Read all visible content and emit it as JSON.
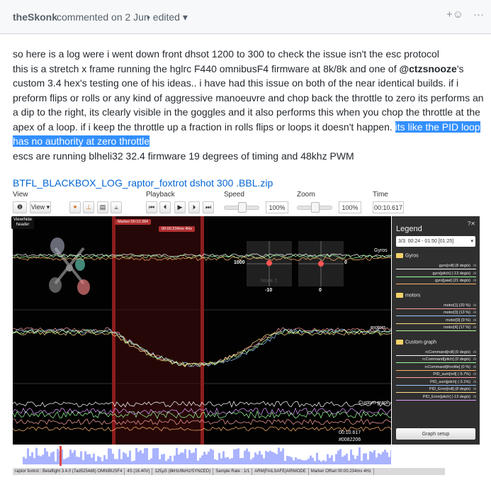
{
  "comment": {
    "author": "theSkonk",
    "meta": "commented on 2 Jun",
    "edited_label": "• edited",
    "edited_caret": "▾",
    "react_icon": "☺",
    "more_icon": "···"
  },
  "body": {
    "p1_line1": "so here is a log were i went down front dhsot 1200 to 300 to check the issue isn't the esc protocol",
    "p1_line2a": "this is a stretch x frame running the hglrc F440 omnibusF4 firmware at 8k/8k and one of ",
    "mention": "@ctzsnooze",
    "p1_line2b": "'s custom 3.4 hex's testing one of his ideas.. i have had this issue on both of the near identical builds. if i preform flips or rolls or any kind of aggressive manoeuvre and chop back the throttle to zero its performs an a dip to the right, its clearly visible in the goggles and it also performs this when you chop the throttle at the apex of a loop. if i keep the throttle up a fraction in rolls flips or loops it doesn't happen. ",
    "highlight": "its like the PID loop has no authority at zero throttle",
    "p2": "escs are running blheli32 32.4 firmware 19 degrees of timing and 48khz PWM"
  },
  "attachment": {
    "name": "BTFL_BLACKBOX_LOG_raptor_foxtrot dshot 300 .BBL.zip"
  },
  "toolbar": {
    "view_label": "View",
    "playback_label": "Playback",
    "speed_label": "Speed",
    "zoom_label": "Zoom",
    "time_label": "Time",
    "info_icon": "❶",
    "view_dropdown": "View ▾",
    "speed_value": "100%",
    "zoom_value": "100%",
    "time_value": "00:10.617",
    "tooltip": "View/hide header",
    "speed_level": 0.5,
    "zoom_level": 0.5
  },
  "graph": {
    "marker_label": "Marker:00:10.384",
    "marker_offset": "00:00.234ms 4Hz",
    "gyros_label": "Gyros",
    "motors_label": "motors",
    "custom_label": "Custom graph",
    "stick_left_value": "1000",
    "stick_right_value": "0",
    "stick_left_bottom": "-10",
    "stick_right_bottom": "0",
    "mode_label": "Mode 2",
    "cursor_time": "00:10.617",
    "cursor_frame": "#0082206"
  },
  "legend": {
    "title": "Legend",
    "help": "?✕",
    "range": "3/3: 00:24 - 01:50 [01:25]",
    "groups": [
      {
        "name": "Gyros",
        "items": [
          {
            "label": "gyro[roll] (8 deg/s)",
            "color": "#ffffff"
          },
          {
            "label": "gyro[pitch] (-13 deg/s)",
            "color": "#9aff9a"
          },
          {
            "label": "gyro[yaw] (21 deg/s)",
            "color": "#ffb36a"
          }
        ]
      },
      {
        "name": "motors",
        "items": [
          {
            "label": "motor[1] (20 %)",
            "color": "#ff9e9e"
          },
          {
            "label": "motor[3] (13 %)",
            "color": "#9ac8ff"
          },
          {
            "label": "motor[0] (9 %)",
            "color": "#ffe08a"
          },
          {
            "label": "motor[4] (17 %)",
            "color": "#b4ff9a"
          }
        ]
      },
      {
        "name": "Custom graph",
        "items": [
          {
            "label": "rcCommand[roll] (0 deg/s)",
            "color": "#ffffff"
          },
          {
            "label": "rcCommand[pitch] (0 deg/s)",
            "color": "#9aff9a"
          },
          {
            "label": "rcCommand[throttle] (0 %)",
            "color": "#ffb36a"
          },
          {
            "label": "PID_sum[roll] (-5.7%)",
            "color": "#ff9e9e"
          },
          {
            "label": "PID_sum[pitch] (-3.1%)",
            "color": "#9ac8ff"
          },
          {
            "label": "PID_Error[roll] (8 deg/s)",
            "color": "#ffe08a"
          },
          {
            "label": "PID_Error[pitch] (-13 deg/s)",
            "color": "#e0a0ff"
          }
        ]
      }
    ],
    "setup_button": "Graph setup"
  },
  "status": [
    "raptor foxtrot : Betaflight 3.4.0 (7ad5254d8) OMNIBUSF4",
    "4S (16.40V)",
    "125µS (8kHz/8kHz/SYNCED)",
    "Sample Rate : 1/1",
    "ARM|FAILSAFE|AIRMODE",
    "Marker Offset 00:00.234ms 4Hz"
  ],
  "colors": {
    "accent_link": "#0366d6",
    "highlight": "#3390ff",
    "marker": "#e04545",
    "seek_fill": "#aab3ff"
  }
}
